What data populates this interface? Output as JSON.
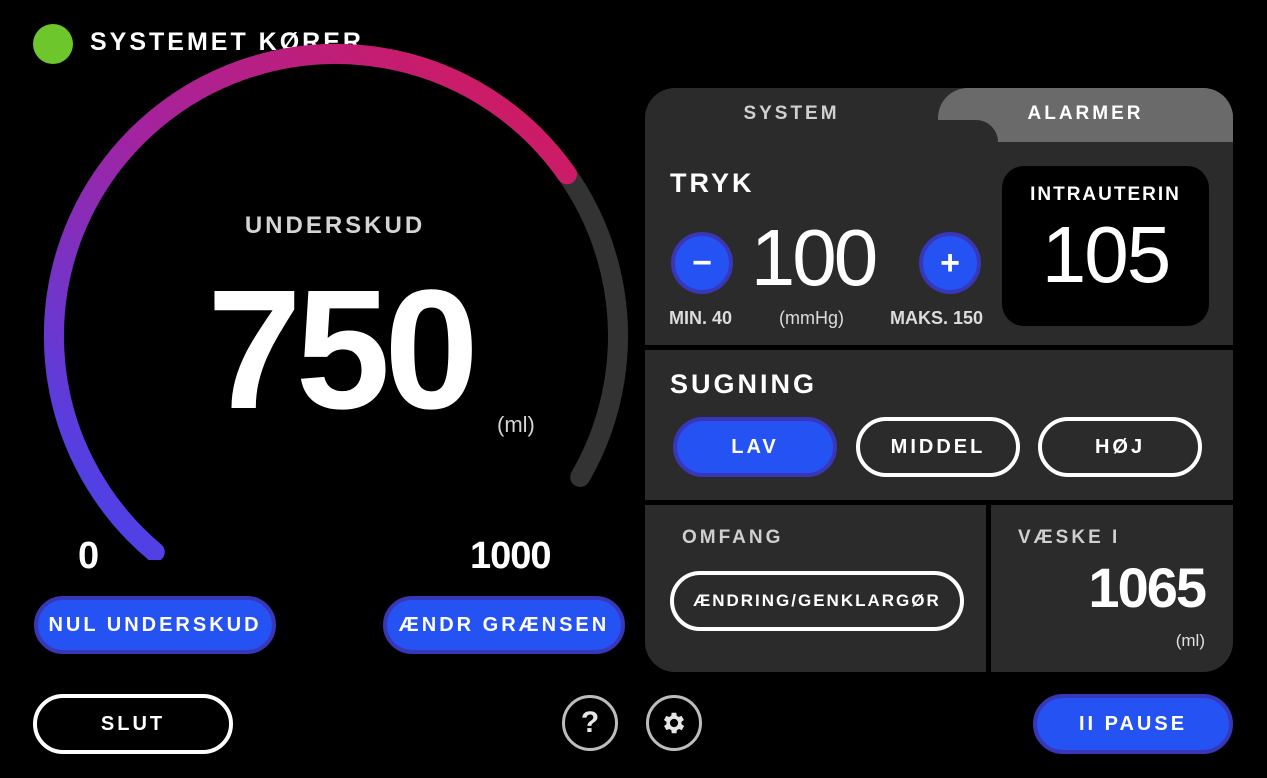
{
  "status": {
    "label": "SYSTEMET KØRER",
    "color": "#6cc62c"
  },
  "gauge": {
    "title": "UNDERSKUD",
    "value": "750",
    "unit": "(ml)",
    "min": "0",
    "max": "1000",
    "fill_fraction": 0.75
  },
  "buttons": {
    "null_deficit": "NUL UNDERSKUD",
    "change_limit": "ÆNDR GRÆNSEN",
    "end": "SLUT",
    "pause": "II PAUSE",
    "help": "?"
  },
  "tabs": {
    "system": "SYSTEM",
    "alarms": "ALARMER"
  },
  "pressure": {
    "title": "TRYK",
    "value": "100",
    "min_label": "MIN. 40",
    "unit_label": "(mmHg)",
    "max_label": "MAKS. 150",
    "minus": "−",
    "plus": "+"
  },
  "intrauterine": {
    "label": "INTRAUTERIN",
    "value": "105"
  },
  "suction": {
    "title": "SUGNING",
    "low": "LAV",
    "medium": "MIDDEL",
    "high": "HØJ",
    "selected": "LAV"
  },
  "scope": {
    "title": "OMFANG",
    "button": "ÆNDRING/GENKLARGØR"
  },
  "fluid_in": {
    "title": "VÆSKE I",
    "value": "1065",
    "unit": "(ml)"
  },
  "colors": {
    "accent": "#2452f3",
    "accent_border": "#3a36b8",
    "panel": "#2b2b2b",
    "gauge_start": "#3d47f5",
    "gauge_mid": "#a323a0",
    "gauge_end": "#d81955"
  }
}
